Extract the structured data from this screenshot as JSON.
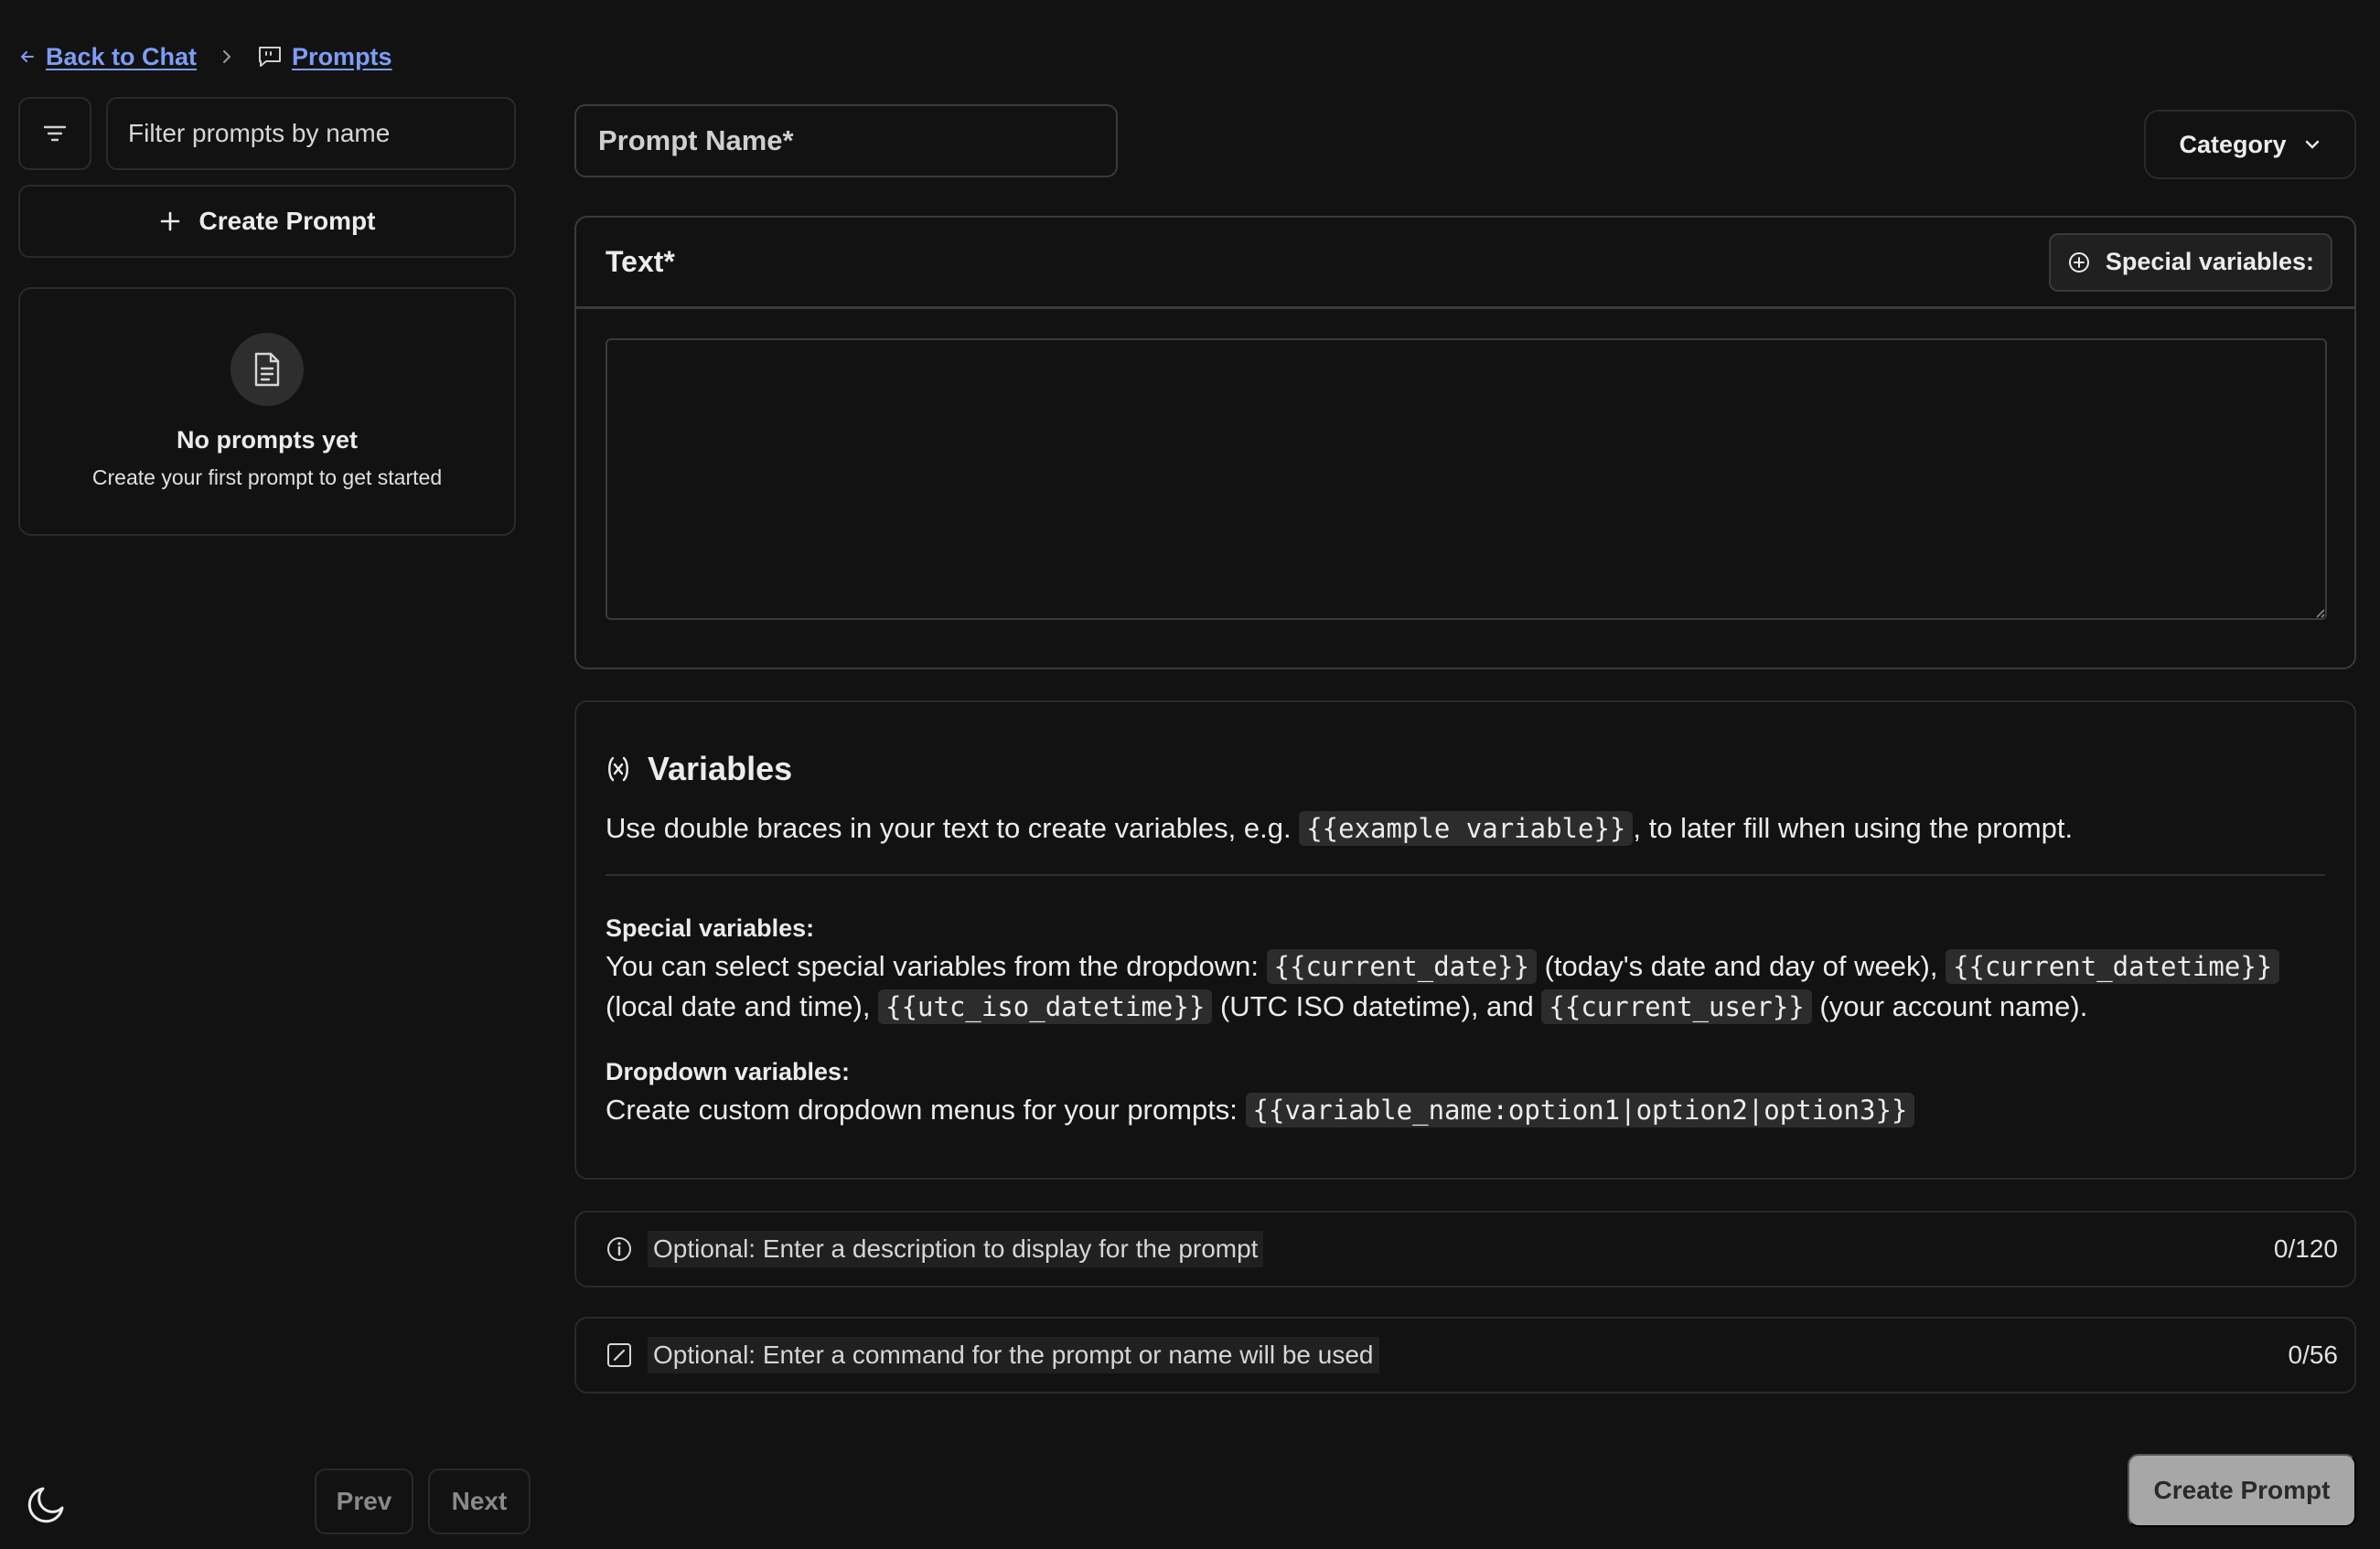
{
  "breadcrumb": {
    "back_label": "Back to Chat",
    "current_label": "Prompts"
  },
  "sidebar": {
    "filter_placeholder": "Filter prompts by name",
    "create_label": "Create Prompt",
    "empty_title": "No prompts yet",
    "empty_subtitle": "Create your first prompt to get started"
  },
  "form": {
    "name_placeholder": "Prompt Name*",
    "category_label": "Category",
    "text_label": "Text*",
    "special_vars_button": "Special variables:",
    "text_value": ""
  },
  "variables": {
    "title": "Variables",
    "desc_before": "Use double braces in your text to create variables, e.g.",
    "desc_code": "{{example variable}}",
    "desc_after": ", to later fill when using the prompt.",
    "special_title": "Special variables:",
    "special_p1": "You can select special variables from the dropdown:",
    "special_c1": "{{current_date}}",
    "special_p2": "(today's date and day of week),",
    "special_c2": "{{current_datetime}}",
    "special_p3": "(local date and time),",
    "special_c3": "{{utc_iso_datetime}}",
    "special_p4": "(UTC ISO datetime), and",
    "special_c4": "{{current_user}}",
    "special_p5": "(your account name).",
    "dropdown_title": "Dropdown variables:",
    "dropdown_text": "Create custom dropdown menus for your prompts:",
    "dropdown_code": "{{variable_name:option1|option2|option3}}"
  },
  "description": {
    "placeholder": "Optional: Enter a description to display for the prompt",
    "count": "0/120"
  },
  "command": {
    "placeholder": "Optional: Enter a command for the prompt or name will be used",
    "count": "0/56"
  },
  "pager": {
    "prev": "Prev",
    "next": "Next"
  },
  "submit_label": "Create Prompt",
  "colors": {
    "background": "#121212",
    "link": "#7d9df5",
    "border": "#2a2a2a",
    "submit_bg": "#a7a7a7"
  },
  "icons": [
    "arrow-left-icon",
    "chevron-right-icon",
    "message-square-quote-icon",
    "filter-lines-icon",
    "plus-icon",
    "file-text-icon",
    "chevron-down-icon",
    "plus-circle-icon",
    "variable-icon",
    "info-icon",
    "square-pen-icon",
    "moon-icon"
  ]
}
